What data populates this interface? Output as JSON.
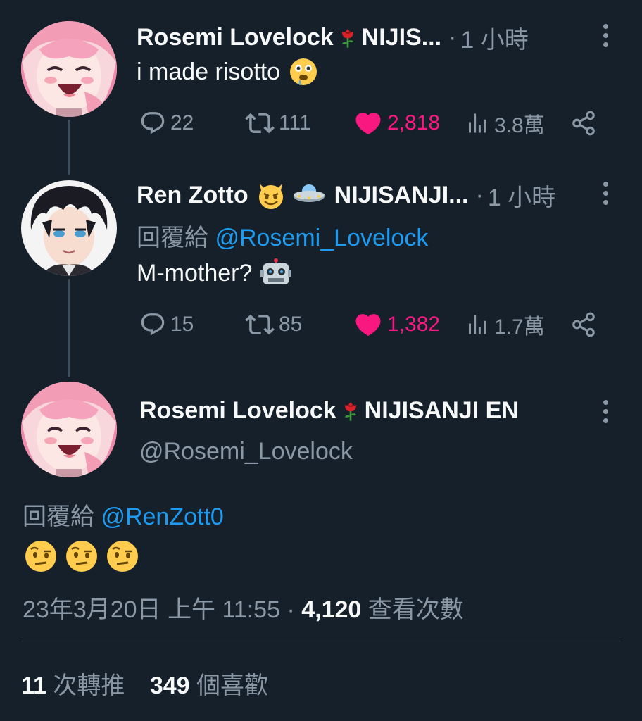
{
  "tweets": [
    {
      "name": "Rosemi Lovelock",
      "name_suffix": "NIJIS...",
      "time": "1 小時",
      "text": "i made risotto",
      "replies": "22",
      "retweets": "111",
      "likes": "2,818",
      "views": "3.8萬"
    },
    {
      "name": "Ren Zotto",
      "name_suffix": "NIJISANJI...",
      "time": "1 小時",
      "reply_prefix": "回覆給",
      "reply_handle": "@Rosemi_Lovelock",
      "text": "M-mother?",
      "replies": "15",
      "retweets": "85",
      "likes": "1,382",
      "views": "1.7萬"
    }
  ],
  "main_tweet": {
    "name": "Rosemi Lovelock",
    "name_suffix": "NIJISANJI EN",
    "handle": "@Rosemi_Lovelock",
    "reply_prefix": "回覆給",
    "reply_handle": "@RenZott0",
    "date": "23年3月20日 上午 11:55",
    "views_count": "4,120",
    "views_label": "查看次數",
    "retweets_count": "11",
    "retweets_label": "次轉推",
    "likes_count": "349",
    "likes_label": "個喜歡"
  },
  "colors": {
    "background": "#15202b",
    "text": "#f7f9f9",
    "muted": "#8b98a5",
    "link": "#1d9bf0",
    "like": "#f91880"
  }
}
